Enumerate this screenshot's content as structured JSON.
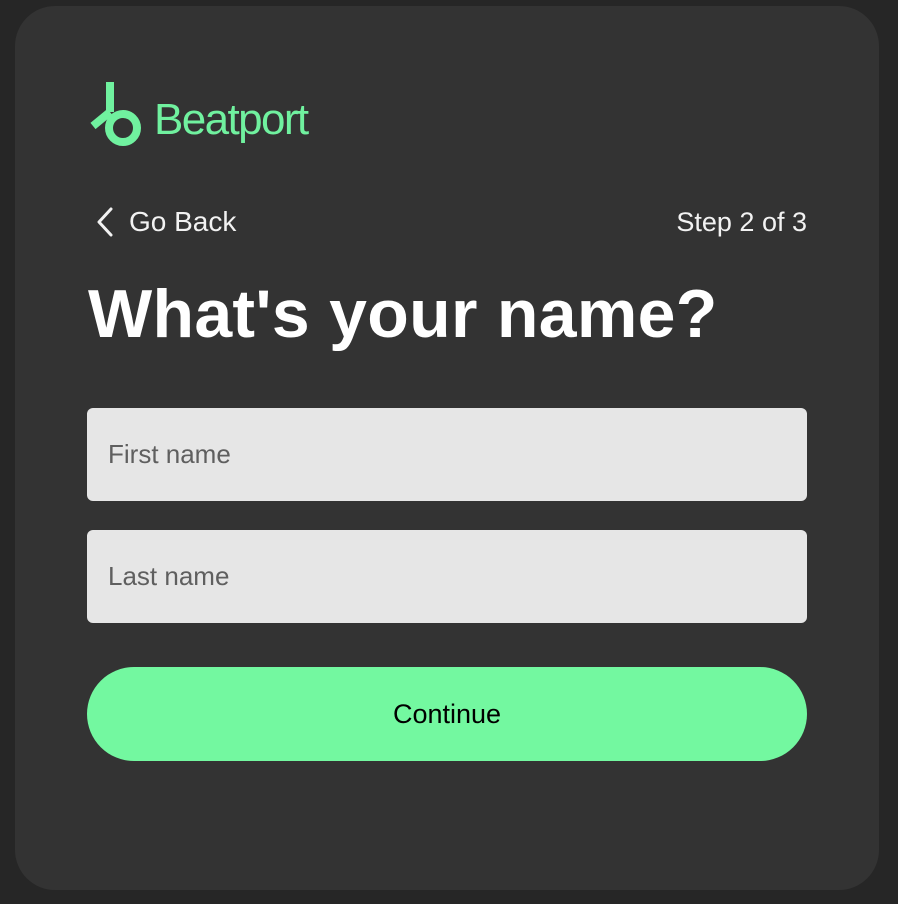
{
  "brand": {
    "name": "Beatport",
    "accent_color": "#70f19f",
    "icon": "beatport-logo-icon"
  },
  "nav": {
    "back_label": "Go Back",
    "back_icon": "chevron-left-icon",
    "step_text": "Step 2 of 3"
  },
  "form": {
    "title": "What's your name?",
    "first_name_placeholder": "First name",
    "first_name_value": "",
    "last_name_placeholder": "Last name",
    "last_name_value": "",
    "continue_label": "Continue",
    "button_color": "#73f8a0"
  }
}
